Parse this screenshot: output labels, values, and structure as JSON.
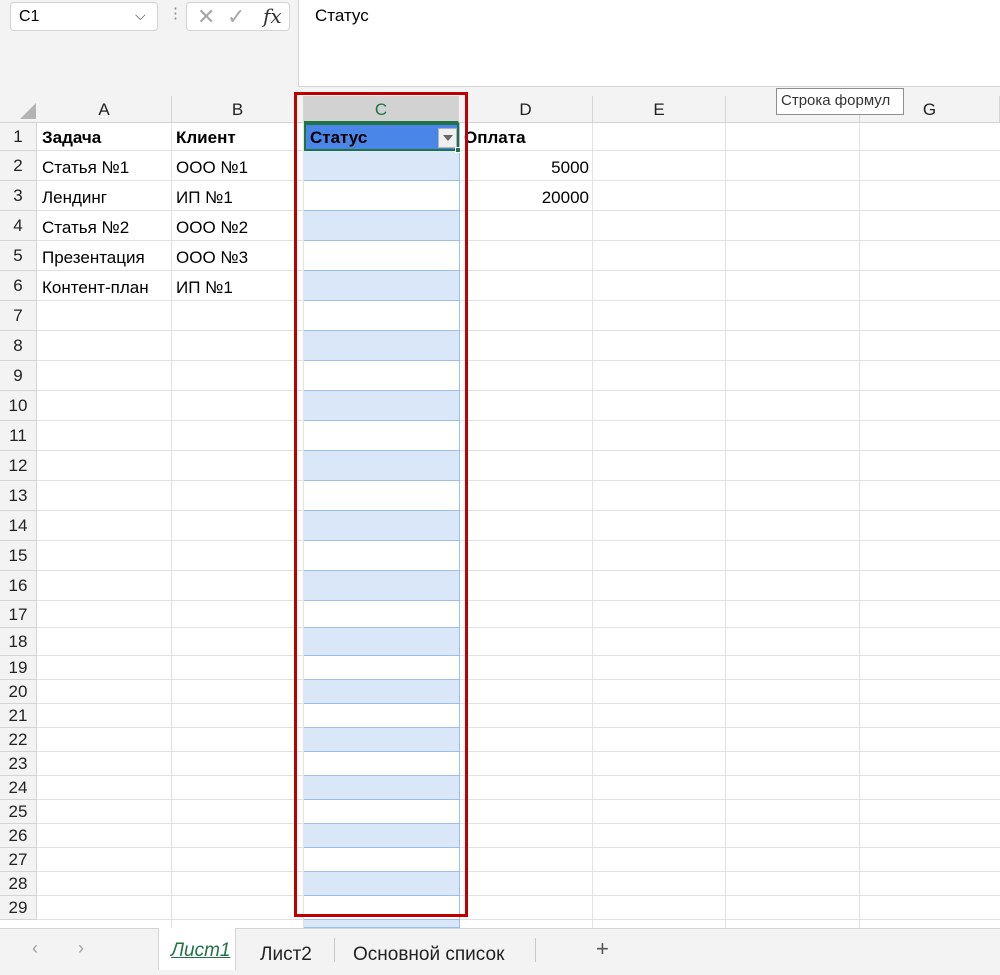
{
  "formula_bar": {
    "name_box": "C1",
    "chevron": "⌵",
    "dots": "⋮",
    "cancel": "✕",
    "enter": "✓",
    "fx": "fx",
    "content": "Статус",
    "tooltip": "Строка формул"
  },
  "columns": [
    "A",
    "B",
    "C",
    "D",
    "E",
    "",
    "G"
  ],
  "rows": [
    "1",
    "2",
    "3",
    "4",
    "5",
    "6",
    "7",
    "8",
    "9",
    "10",
    "11",
    "12",
    "13",
    "14",
    "15",
    "16",
    "17",
    "18",
    "19",
    "20",
    "21",
    "22",
    "23",
    "24",
    "25",
    "26",
    "27",
    "28",
    "29"
  ],
  "headers": {
    "a1": "Задача",
    "b1": "Клиент",
    "c1": "Статус",
    "d1": "Оплата"
  },
  "cells": {
    "a": [
      "Статья №1",
      "Лендинг",
      "Статья №2",
      "Презентация",
      "Контент-план"
    ],
    "b": [
      "ООО №1",
      "ИП №1",
      "ООО №2",
      "ООО №3",
      "ИП №1"
    ],
    "d": [
      "5000",
      "20000"
    ]
  },
  "sheets": {
    "prev": "‹",
    "next": "›",
    "tabs": [
      "Лист1",
      "Лист2",
      "Основной список"
    ],
    "add": "+"
  },
  "colors": {
    "accent": "#217346",
    "highlight": "#c00000",
    "header_fill": "#4a86e8",
    "band": "#dae7f8"
  }
}
